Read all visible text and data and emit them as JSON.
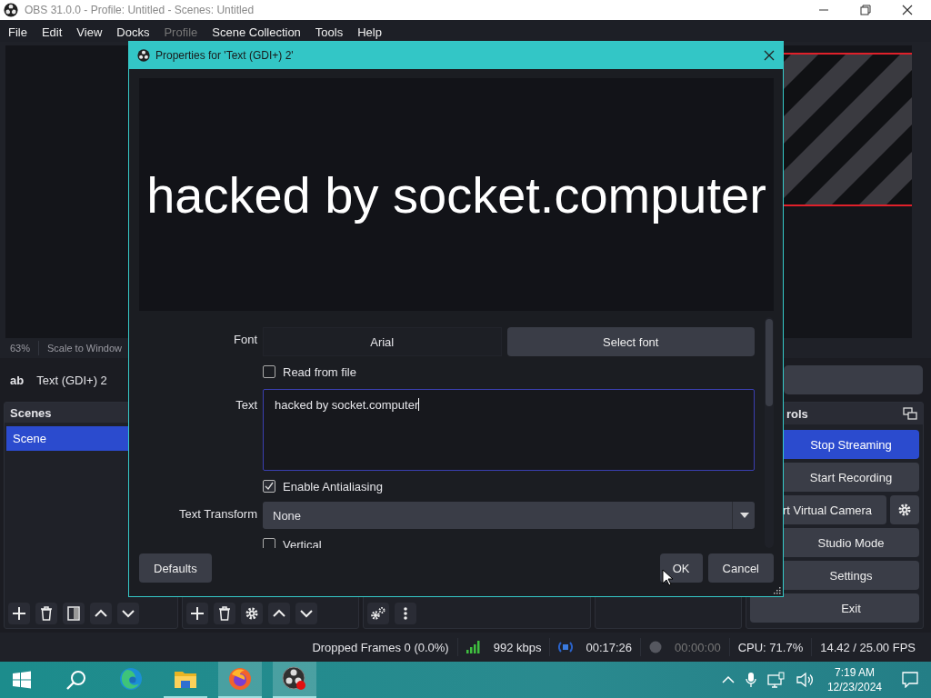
{
  "window": {
    "title": "OBS 31.0.0 - Profile: Untitled - Scenes: Untitled"
  },
  "menu": [
    {
      "label": "File",
      "disabled": false
    },
    {
      "label": "Edit",
      "disabled": false
    },
    {
      "label": "View",
      "disabled": false
    },
    {
      "label": "Docks",
      "disabled": false
    },
    {
      "label": "Profile",
      "disabled": true
    },
    {
      "label": "Scene Collection",
      "disabled": false
    },
    {
      "label": "Tools",
      "disabled": false
    },
    {
      "label": "Help",
      "disabled": false
    }
  ],
  "preview": {
    "zoom": "63%",
    "scale_mode": "Scale to Window"
  },
  "source_bar": {
    "type_badge": "ab",
    "name": "Text (GDI+) 2"
  },
  "scenes_dock": {
    "title": "Scenes",
    "items": [
      {
        "label": "Scene",
        "selected": true
      }
    ]
  },
  "controls_dock": {
    "title": "rols",
    "buttons": [
      {
        "label": "Stop Streaming",
        "active": true,
        "kind": "plain"
      },
      {
        "label": "Start Recording",
        "active": false,
        "kind": "plain"
      },
      {
        "label": "rt Virtual Camera",
        "active": false,
        "kind": "with_settings"
      },
      {
        "label": "Studio Mode",
        "active": false,
        "kind": "plain"
      },
      {
        "label": "Settings",
        "active": false,
        "kind": "plain"
      },
      {
        "label": "Exit",
        "active": false,
        "kind": "plain"
      }
    ]
  },
  "status_bar": {
    "dropped_frames": "Dropped Frames 0 (0.0%)",
    "bitrate": "992 kbps",
    "stream_time": "00:17:26",
    "record_time": "00:00:00",
    "cpu": "CPU: 71.7%",
    "fps": "14.42 / 25.00 FPS"
  },
  "taskbar": {
    "apps": [
      {
        "kind": "edge",
        "running": false,
        "selected": false
      },
      {
        "kind": "folder",
        "running": true,
        "selected": false
      },
      {
        "kind": "firefox",
        "running": true,
        "selected": true
      },
      {
        "kind": "obs",
        "running": true,
        "selected": true
      }
    ],
    "time": "7:19 AM",
    "date": "12/23/2024"
  },
  "dialog": {
    "title": "Properties for 'Text (GDI+) 2'",
    "preview_text": "hacked by socket.computer",
    "properties": [
      {
        "kind": "font",
        "label": "Font",
        "value": "Arial",
        "button": "Select font"
      },
      {
        "kind": "checkbox",
        "label": "Read from file",
        "checked": false
      },
      {
        "kind": "textarea",
        "label": "Text",
        "value": "hacked by socket.computer"
      },
      {
        "kind": "checkbox",
        "label": "Enable Antialiasing",
        "checked": true
      },
      {
        "kind": "select",
        "label": "Text Transform",
        "value": "None"
      },
      {
        "kind": "checkbox",
        "label": "Vertical",
        "checked": false
      }
    ],
    "defaults_button": "Defaults",
    "ok_button": "OK",
    "cancel_button": "Cancel"
  }
}
